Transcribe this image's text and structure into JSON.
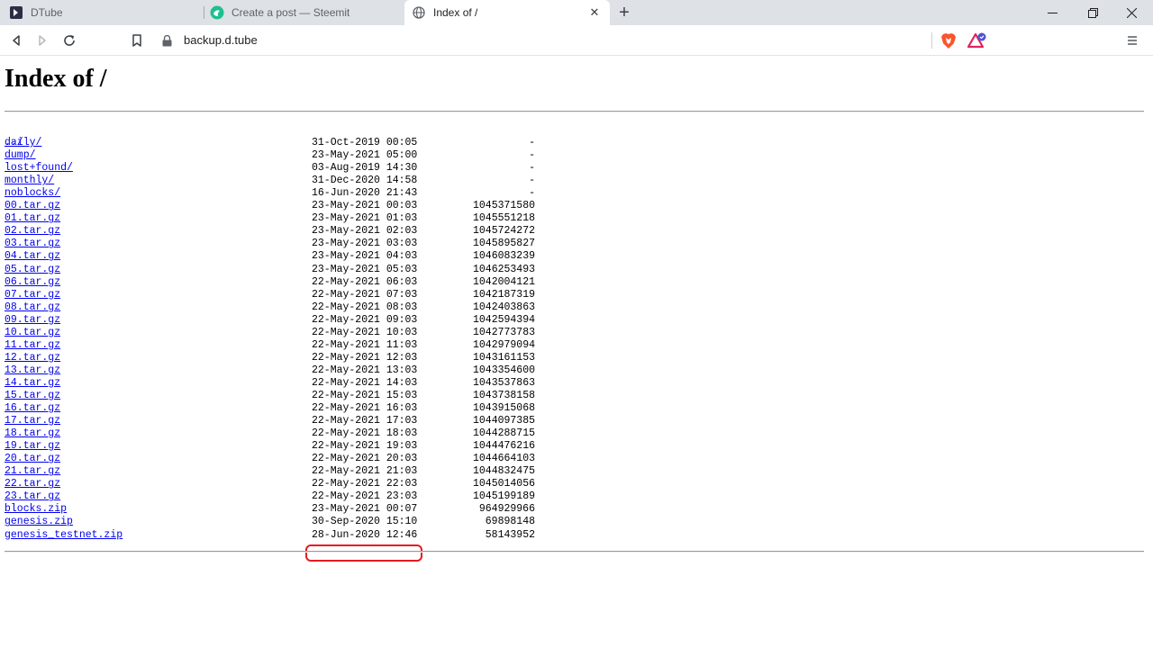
{
  "browser": {
    "tabs": [
      {
        "title": "DTube",
        "favicon": "dtube-icon"
      },
      {
        "title": "Create a post — Steemit",
        "favicon": "steemit-icon"
      },
      {
        "title": "Index of /",
        "favicon": "globe-icon",
        "active": true
      }
    ],
    "url": "backup.d.tube"
  },
  "page": {
    "heading": "Index of /",
    "parent_link": "../",
    "entries": [
      {
        "name": "daily/",
        "date": "31-Oct-2019 00:05",
        "size": "-"
      },
      {
        "name": "dump/",
        "date": "23-May-2021 05:00",
        "size": "-"
      },
      {
        "name": "lost+found/",
        "date": "03-Aug-2019 14:30",
        "size": "-"
      },
      {
        "name": "monthly/",
        "date": "31-Dec-2020 14:58",
        "size": "-"
      },
      {
        "name": "noblocks/",
        "date": "16-Jun-2020 21:43",
        "size": "-"
      },
      {
        "name": "00.tar.gz",
        "date": "23-May-2021 00:03",
        "size": "1045371580"
      },
      {
        "name": "01.tar.gz",
        "date": "23-May-2021 01:03",
        "size": "1045551218"
      },
      {
        "name": "02.tar.gz",
        "date": "23-May-2021 02:03",
        "size": "1045724272"
      },
      {
        "name": "03.tar.gz",
        "date": "23-May-2021 03:03",
        "size": "1045895827"
      },
      {
        "name": "04.tar.gz",
        "date": "23-May-2021 04:03",
        "size": "1046083239"
      },
      {
        "name": "05.tar.gz",
        "date": "23-May-2021 05:03",
        "size": "1046253493"
      },
      {
        "name": "06.tar.gz",
        "date": "22-May-2021 06:03",
        "size": "1042004121"
      },
      {
        "name": "07.tar.gz",
        "date": "22-May-2021 07:03",
        "size": "1042187319"
      },
      {
        "name": "08.tar.gz",
        "date": "22-May-2021 08:03",
        "size": "1042403863"
      },
      {
        "name": "09.tar.gz",
        "date": "22-May-2021 09:03",
        "size": "1042594394"
      },
      {
        "name": "10.tar.gz",
        "date": "22-May-2021 10:03",
        "size": "1042773783"
      },
      {
        "name": "11.tar.gz",
        "date": "22-May-2021 11:03",
        "size": "1042979094"
      },
      {
        "name": "12.tar.gz",
        "date": "22-May-2021 12:03",
        "size": "1043161153"
      },
      {
        "name": "13.tar.gz",
        "date": "22-May-2021 13:03",
        "size": "1043354600"
      },
      {
        "name": "14.tar.gz",
        "date": "22-May-2021 14:03",
        "size": "1043537863"
      },
      {
        "name": "15.tar.gz",
        "date": "22-May-2021 15:03",
        "size": "1043738158"
      },
      {
        "name": "16.tar.gz",
        "date": "22-May-2021 16:03",
        "size": "1043915068"
      },
      {
        "name": "17.tar.gz",
        "date": "22-May-2021 17:03",
        "size": "1044097385"
      },
      {
        "name": "18.tar.gz",
        "date": "22-May-2021 18:03",
        "size": "1044288715"
      },
      {
        "name": "19.tar.gz",
        "date": "22-May-2021 19:03",
        "size": "1044476216"
      },
      {
        "name": "20.tar.gz",
        "date": "22-May-2021 20:03",
        "size": "1044664103"
      },
      {
        "name": "21.tar.gz",
        "date": "22-May-2021 21:03",
        "size": "1044832475"
      },
      {
        "name": "22.tar.gz",
        "date": "22-May-2021 22:03",
        "size": "1045014056"
      },
      {
        "name": "23.tar.gz",
        "date": "22-May-2021 23:03",
        "size": "1045199189",
        "highlighted": true
      },
      {
        "name": "blocks.zip",
        "date": "23-May-2021 00:07",
        "size": "964929966"
      },
      {
        "name": "genesis.zip",
        "date": "30-Sep-2020 15:10",
        "size": "69898148"
      },
      {
        "name": "genesis_testnet.zip",
        "date": "28-Jun-2020 12:46",
        "size": "58143952"
      }
    ]
  },
  "colors": {
    "link": "#0000ee",
    "annotation": "#e31b23"
  }
}
